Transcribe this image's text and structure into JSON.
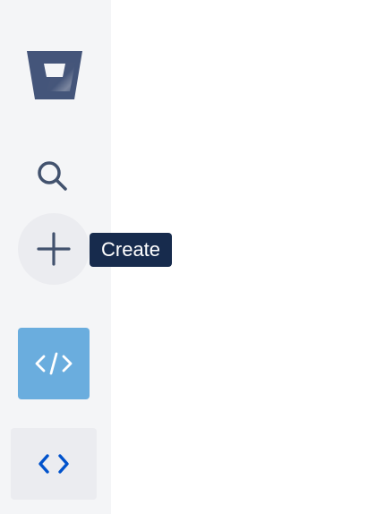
{
  "sidebar": {
    "logo_icon": "bitbucket-logo",
    "search": {
      "icon": "search-icon"
    },
    "create": {
      "icon": "plus-icon",
      "tooltip": "Create"
    },
    "nav": [
      {
        "icon": "code-slash-icon",
        "active": true
      },
      {
        "icon": "code-chevrons-icon",
        "active": false
      }
    ]
  },
  "colors": {
    "sidebar_bg": "#f4f5f7",
    "button_bg": "#ebecf0",
    "tooltip_bg": "#172b4d",
    "active_bg": "#6aadde",
    "icon_dark": "#42526e",
    "icon_blue": "#0052cc"
  }
}
